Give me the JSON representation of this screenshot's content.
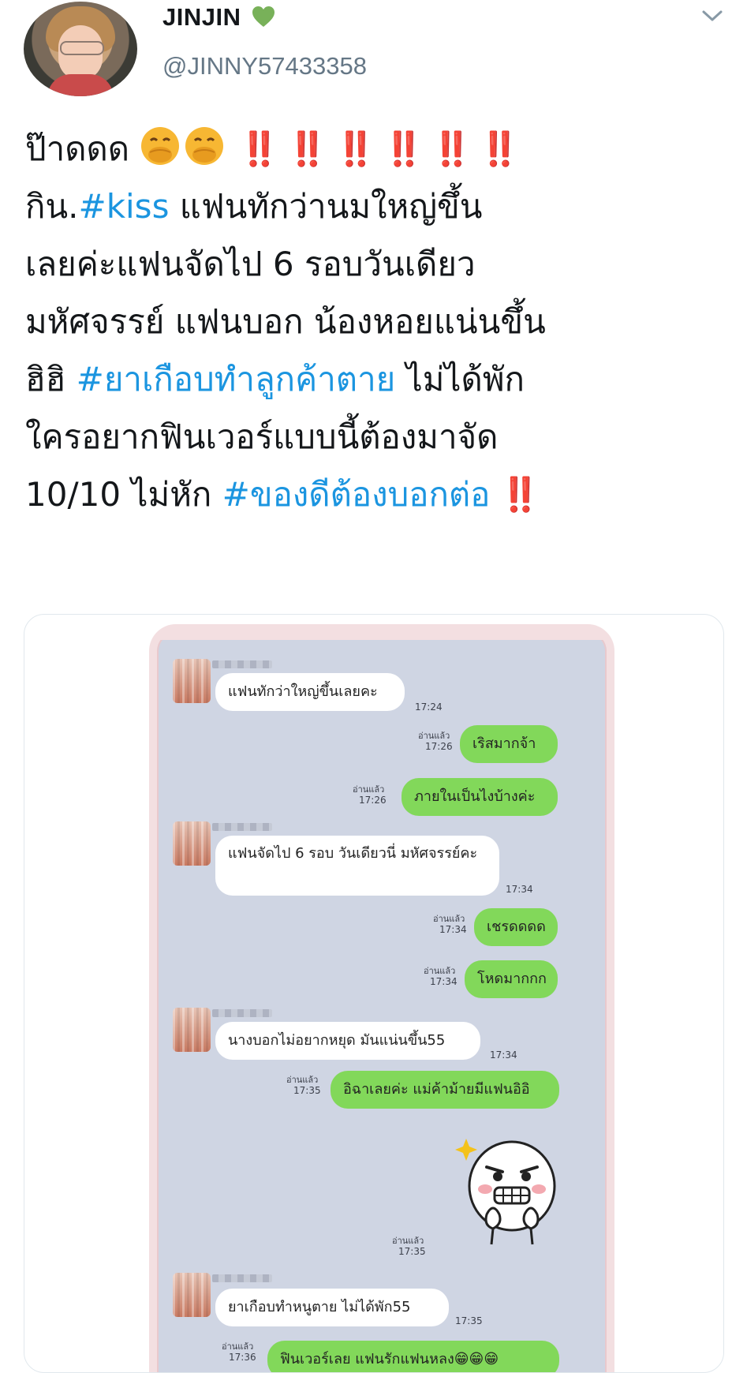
{
  "tweet": {
    "display_name": "JINJIN",
    "handle": "@JINNY57433358",
    "line1_text": "ป๊าดดด",
    "line1_marks": "‼️ ‼️ ‼️ ‼️ ‼️ ‼️",
    "line2_prefix": "กิน.",
    "line2_hashtag": "#kiss",
    "line2_rest": " แฟนทักว่านมใหญ่ขึ้น",
    "line3": "เลยค่ะแฟนจัดไป 6 รอบวันเดียว",
    "line4": "มหัศจรรย์ แฟนบอก น้องหอยแน่นขึ้น",
    "line5_prefix": "ฮิฮิ ",
    "line5_hashtag": "#ยาเกือบทำลูกค้าตาย",
    "line5_rest": " ไม่ได้พัก",
    "line6": "ใครอยากฟินเวอร์แบบนี้ต้องมาจัด",
    "line7_prefix": "10/10 ไม่หัก ",
    "line7_hashtag": "#ของดีต้องบอกต่อ",
    "line7_marks": " ‼️"
  },
  "icons": {
    "verified_heart": "green-heart-icon",
    "menu": "chevron-down-icon",
    "emoji": "face-with-hand-over-mouth-icon"
  },
  "colors": {
    "hashtag": "#1b95e0",
    "marks": "#c4182c",
    "outgoing_bubble": "#82d85a",
    "incoming_bubble": "#ffffff",
    "chat_bg": "#cfd5e3"
  },
  "chat": {
    "messages": [
      {
        "side": "in",
        "text": "แฟนทักว่าใหญ่ขึ้นเลยคะ",
        "time": "17:24"
      },
      {
        "side": "out",
        "text": "เริสมากจ้า",
        "read": "อ่านแล้ว",
        "time": "17:26"
      },
      {
        "side": "out",
        "text": "ภายในเป็นไงบ้างค่ะ",
        "read": "อ่านแล้ว",
        "time": "17:26"
      },
      {
        "side": "in",
        "text": "แฟนจัดไป 6 รอบ วันเดียวนี่ มหัศจรรย์คะ",
        "time": "17:34"
      },
      {
        "side": "out",
        "text": "เชรดดดด",
        "read": "อ่านแล้ว",
        "time": "17:34"
      },
      {
        "side": "out",
        "text": "โหดมากกก",
        "read": "อ่านแล้ว",
        "time": "17:34"
      },
      {
        "side": "in",
        "text": "นางบอกไม่อยากหยุด มันแน่นขึ้น55",
        "time": "17:34"
      },
      {
        "side": "out",
        "text": "อิฉาเลยค่ะ แม่ค้าม้ายมีแฟนอิอิ",
        "read": "อ่านแล้ว",
        "time": "17:35"
      },
      {
        "side": "out",
        "text": "",
        "read": "อ่านแล้ว",
        "time": "17:35"
      },
      {
        "side": "in",
        "text": "ยาเกือบทำหนูตาย ไม่ได้พัก55",
        "time": "17:35"
      },
      {
        "side": "out",
        "text": "ฟินเวอร์เลย แฟนรักแฟนหลง😁😁😁",
        "read": "อ่านแล้ว",
        "time": "17:36"
      }
    ]
  }
}
